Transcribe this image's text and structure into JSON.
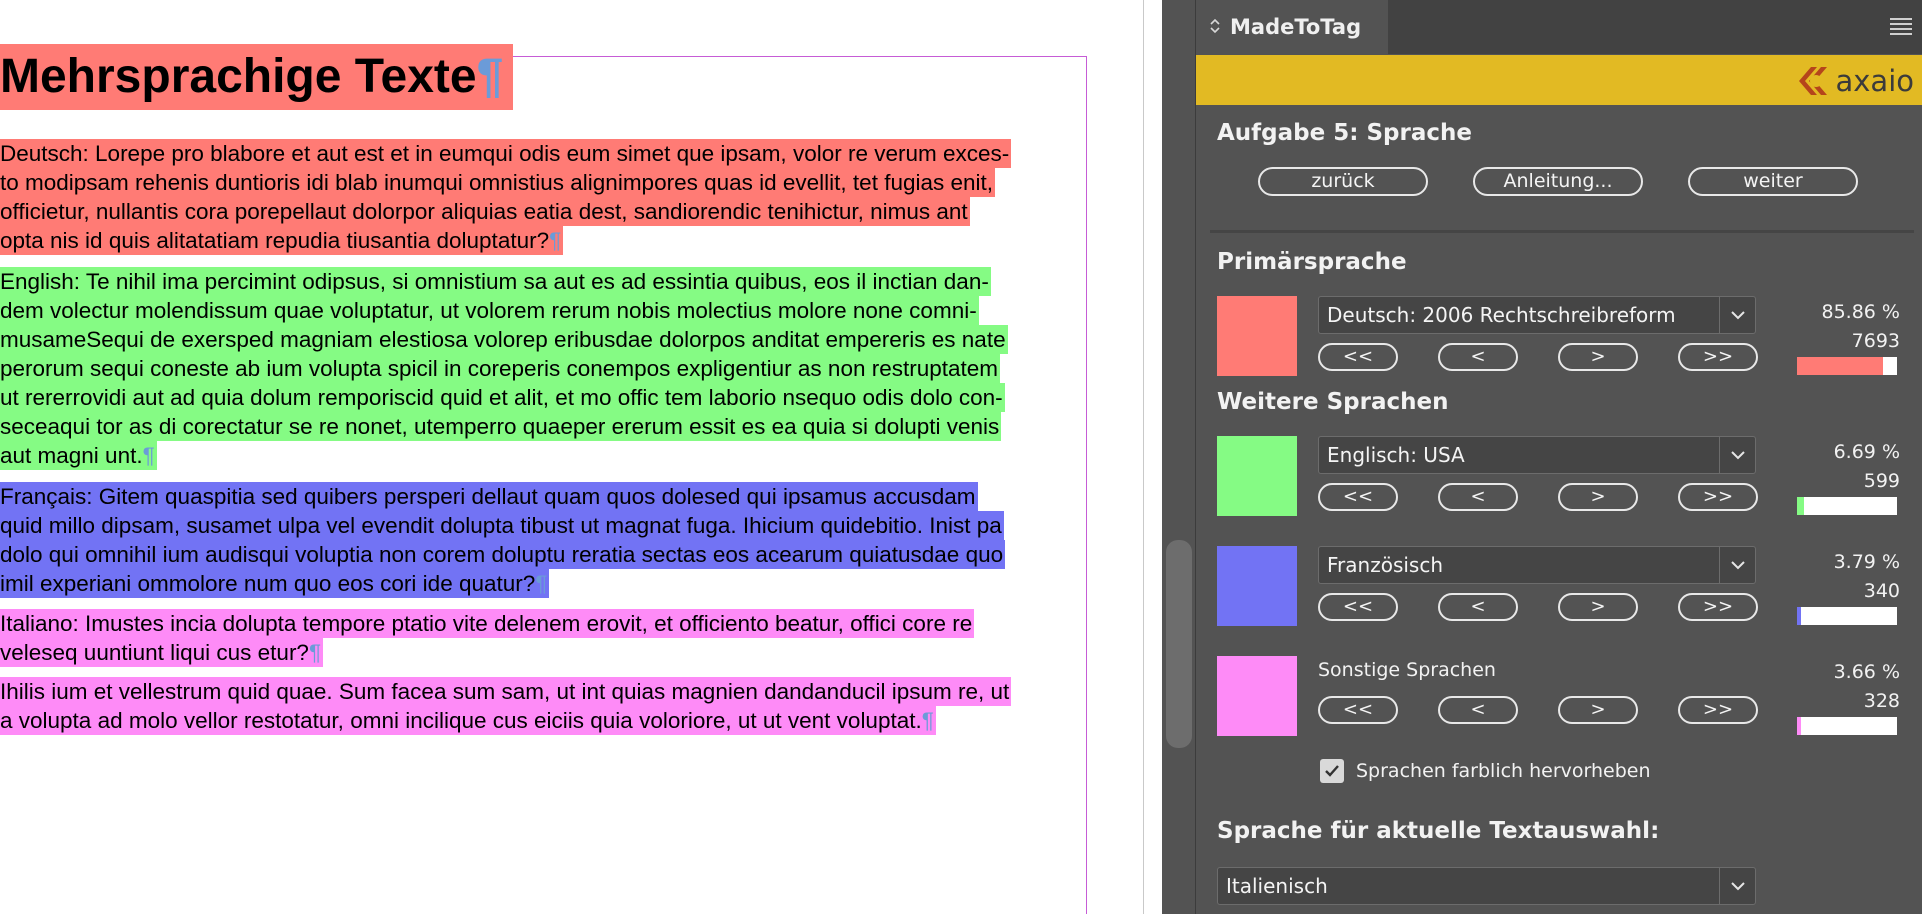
{
  "document": {
    "title": "Mehrsprachige Texte",
    "pilcrow": "¶",
    "paragraphs": [
      {
        "color": "#ff7b75",
        "lines": [
          "Deutsch: Lorepe pro blabore et aut est et in eumqui odis eum simet que ipsam, volor re verum exces-",
          "to modipsam rehenis duntioris idi blab inumqui omnistius alignimpores quas id evellit, tet fugias enit,",
          "officietur, nullantis cora porepellaut dolorpor aliquias eatia dest, sandiorendic tenihictur, nimus ant",
          "opta nis id quis alitatatiam repudia tiusantia doluptatur?"
        ]
      },
      {
        "color": "#85fb84",
        "lines": [
          "English: Te nihil ima percimint odipsus, si omnistium sa aut es ad essintia quibus, eos il inctian dan-",
          "dem volectur molendissum quae voluptatur, ut volorem rerum nobis molectius molore none comni-",
          "musameSequi de exersped magniam elestiosa volorep eribusdae dolorpos anditat empereris es nate",
          "perorum sequi coneste ab ium volupta spicil in coreperis conempos expligentiur as non restruptatem",
          "ut rererrovidi aut ad quia dolum remporiscid quid et alit, et mo offic tem laborio nsequo odis dolo con-",
          "seceaqui tor as di corectatur se re nonet, utemperro quaeper ererum essit es ea quia si dolupti venis",
          "aut magni unt."
        ]
      },
      {
        "color": "#7273f4",
        "lines": [
          "Français: Gitem quaspitia sed quibers persperi dellaut quam quos dolesed qui ipsamus accusdam",
          "quid millo dipsam, susamet ulpa vel evendit dolupta tibust ut magnat fuga. Ihicium quidebitio. Inist pa",
          "dolo qui omnihil ium audisqui voluptia non corem doluptu reratia sectas eos acearum quiatusdae quo",
          "imil experiani ommolore num quo eos cori ide quatur?"
        ]
      },
      {
        "color": "#fe8bf7",
        "lines": [
          "Italiano: Imustes incia dolupta tempore ptatio vite delenem erovit, et officiento beatur, offici core re",
          "veleseq uuntiunt liqui cus etur?"
        ]
      },
      {
        "color": "#fe8bf7",
        "lines": [
          "Ihilis ium et vellestrum quid quae. Sum facea sum sam, ut int quias magnien dandanducil ipsum re, ut",
          "a volupta ad molo vellor restotatur, omni incilique cus eiciis quia voloriore, ut ut vent voluptat."
        ]
      }
    ]
  },
  "panel": {
    "tab_title": "MadeToTag",
    "tab_icon": "collapse-arrows-icon",
    "menu_icon": "panel-menu-icon",
    "brand": {
      "name": "axaio",
      "color": "#e2ba23"
    },
    "task_heading": "Aufgabe 5: Sprache",
    "nav": {
      "back": "zurück",
      "guide": "Anleitung...",
      "next": "weiter"
    },
    "primary_heading": "Primärsprache",
    "further_heading": "Weitere Sprachen",
    "step_labels": {
      "first": "<<",
      "prev": "<",
      "next": ">",
      "last": ">>"
    },
    "languages": [
      {
        "label": "Deutsch: 2006 Rechtschreibreform",
        "color": "#ff7b75",
        "percent": "85.86 %",
        "count": "7693",
        "fraction": 0.8586,
        "dropdown": true
      },
      {
        "label": "Englisch: USA",
        "color": "#85fb84",
        "percent": "6.69 %",
        "count": "599",
        "fraction": 0.0669,
        "dropdown": true
      },
      {
        "label": "Französisch",
        "color": "#7273f4",
        "percent": "3.79 %",
        "count": "340",
        "fraction": 0.0379,
        "dropdown": true
      },
      {
        "label": "Sonstige Sprachen",
        "color": "#fe8bf7",
        "percent": "3.66 %",
        "count": "328",
        "fraction": 0.0366,
        "dropdown": false
      }
    ],
    "highlight_checkbox": {
      "label": "Sprachen farblich hervorheben",
      "checked": true
    },
    "selection_heading": "Sprache für aktuelle Textauswahl:",
    "selection_value": "Italienisch"
  }
}
